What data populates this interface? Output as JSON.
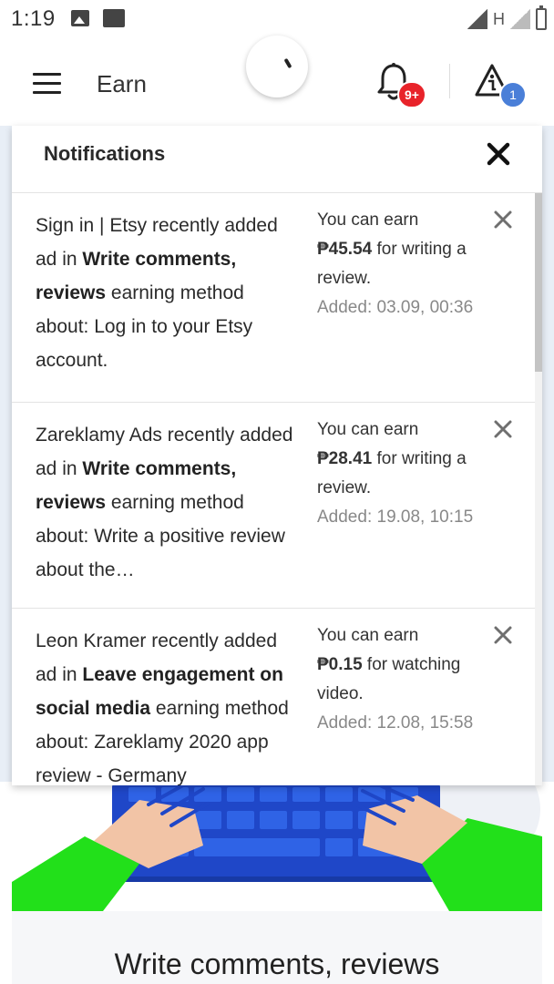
{
  "status_bar": {
    "time": "1:19",
    "network": "H"
  },
  "header": {
    "title": "Earn",
    "notifications_badge": "9+",
    "alerts_badge": "1"
  },
  "notifications": {
    "title": "Notifications",
    "items": [
      {
        "text_before": "Sign in | Etsy recently added ad in ",
        "method": "Write comments, reviews",
        "text_after": " earning method about: Log in to your Etsy account.",
        "earn_prefix": "You can earn",
        "amount": "₱45.54",
        "earn_suffix": " for writing a review.",
        "added": "Added: 03.09, 00:36"
      },
      {
        "text_before": "Zareklamy Ads recently added ad in ",
        "method": "Write comments, reviews",
        "text_after": " earning method about: Write a positive review about the…",
        "earn_prefix": "You can earn",
        "amount": "₱28.41",
        "earn_suffix": " for writing a review.",
        "added": "Added: 19.08, 10:15"
      },
      {
        "text_before": "Leon Kramer recently added ad in ",
        "method": "Leave engagement on social media",
        "text_after": " earning method about: Zareklamy 2020 app review - Germany",
        "earn_prefix": "You can earn",
        "amount": "₱0.15",
        "earn_suffix": " for watching video.",
        "added": "Added: 12.08, 15:58"
      }
    ]
  },
  "content": {
    "title": "Write comments, reviews"
  },
  "colors": {
    "badge_red": "#e8232a",
    "badge_blue": "#4a7fd8",
    "hero_keyboard": "#1f47c8",
    "hero_sleeve": "#22e01a",
    "hero_hand": "#f2c4a6"
  },
  "icons": [
    "menu-icon",
    "bell-icon",
    "alert-icon",
    "close-icon",
    "dismiss-icon",
    "loading-spinner"
  ]
}
